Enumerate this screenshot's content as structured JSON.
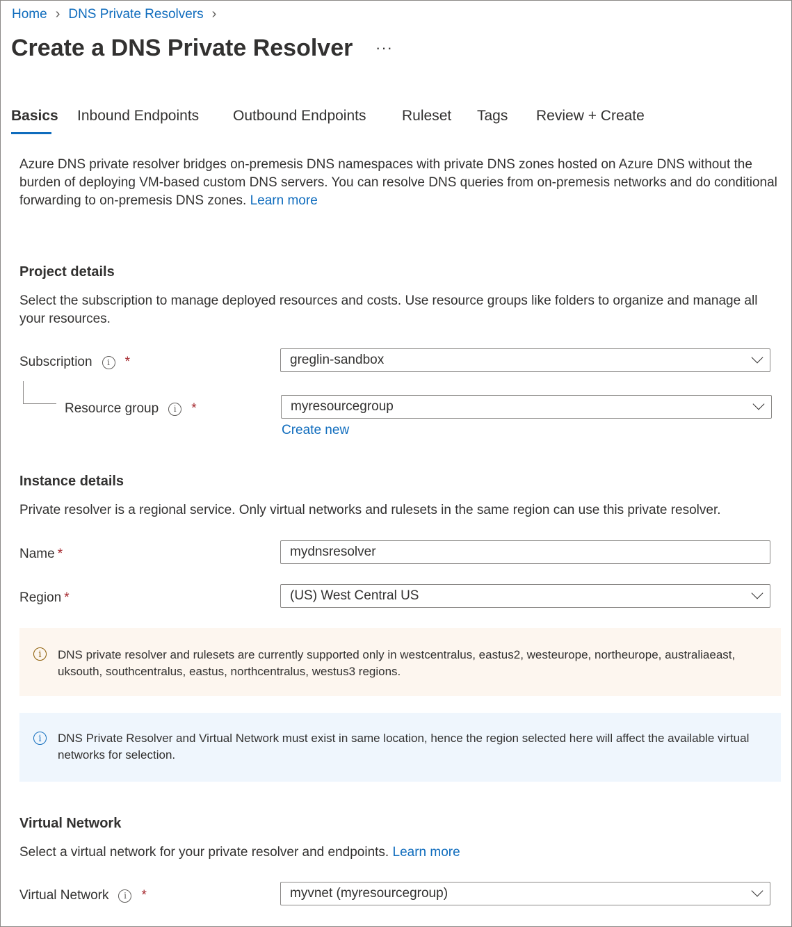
{
  "breadcrumb": [
    "Home",
    "DNS Private Resolvers"
  ],
  "page": {
    "title": "Create a DNS Private Resolver",
    "more": "···"
  },
  "tabs": [
    "Basics",
    "Inbound Endpoints",
    "Outbound Endpoints",
    "Ruleset",
    "Tags",
    "Review + Create"
  ],
  "active_tab": "Basics",
  "intro": {
    "text": "Azure DNS private resolver bridges on-premesis DNS namespaces with private DNS zones hosted on Azure DNS without the burden of deploying VM-based custom DNS servers. You can resolve DNS queries from on-premesis networks and do conditional forwarding to on-premesis DNS zones.",
    "link": "Learn more"
  },
  "project": {
    "heading": "Project details",
    "description": "Select the subscription to manage deployed resources and costs. Use resource groups like folders to organize and manage all your resources.",
    "subscription_label": "Subscription",
    "subscription_value": "greglin-sandbox",
    "resource_group_label": "Resource group",
    "resource_group_value": "myresourcegroup",
    "create_new": "Create new"
  },
  "instance": {
    "heading": "Instance details",
    "description": "Private resolver is a regional service. Only virtual networks and rulesets in the same region can use this private resolver.",
    "name_label": "Name",
    "name_value": "mydnsresolver",
    "region_label": "Region",
    "region_value": "(US) West Central US"
  },
  "warning": "DNS private resolver and rulesets are currently supported only in westcentralus, eastus2, westeurope, northeurope, australiaeast, uksouth, southcentralus, eastus, northcentralus, westus3 regions.",
  "info": "DNS Private Resolver and Virtual Network must exist in same location, hence the region selected here will affect the available virtual networks for selection.",
  "vnet": {
    "heading": "Virtual Network",
    "description": "Select a virtual network for your private resolver and endpoints.",
    "link": "Learn more",
    "label": "Virtual Network",
    "value": "myvnet (myresourcegroup)"
  },
  "required_mark": "*",
  "info_glyph": "i",
  "colors": {
    "link": "#0f6cbd",
    "required": "#a4262c",
    "warning_bg": "#fdf6ef",
    "warning_icon": "#8a5a00",
    "info_bg": "#eff6fd",
    "info_icon": "#0f6cbd"
  }
}
